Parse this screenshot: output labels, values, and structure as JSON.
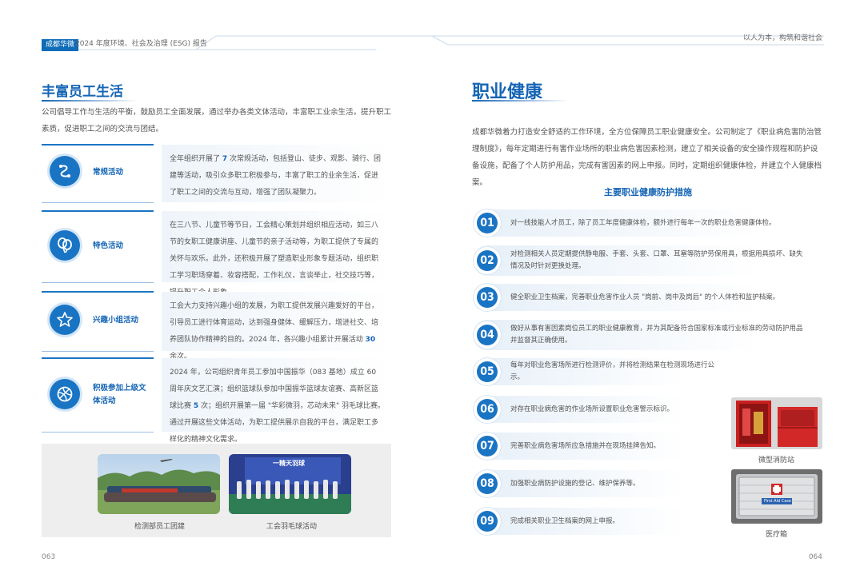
{
  "header": {
    "badge": "成都华微",
    "title": "2024 年度环境、社会及治理 (ESG) 报告",
    "right": "以人为本，构筑和谐社会"
  },
  "left": {
    "title": "丰富员工生活",
    "intro": "公司倡导工作与生活的平衡，鼓励员工全面发展，通过举办各类文体活动，丰富职工业余生活，提升职工素质，促进职工之间的交流与团结。",
    "activities": [
      {
        "icon": "activity-icon",
        "label": "常规活动",
        "pre": "全年组织开展了 ",
        "num": "7",
        "post": " 次常规活动，包括登山、徒步、观影、骑行、团建等活动，吸引众多职工积极参与，丰富了职工的业余生活，促进了职工之间的交流与互动，增强了团队凝聚力。"
      },
      {
        "icon": "balloon-icon",
        "label": "特色活动",
        "pre": "在三八节、儿童节等节日，工会精心策划并组织相应活动，如三八节的女职工健康讲座、儿童节的亲子活动等，为职工提供了专属的关怀与欢乐。此外，还积极开展了塑造职业形象专题活动，组织职工学习职场穿着、妆容搭配，工作礼仪，言谈举止，社交技巧等，提升职工个人形象。",
        "num": "",
        "post": ""
      },
      {
        "icon": "star-icon",
        "label": "兴趣小组活动",
        "pre": "工会大力支持兴趣小组的发展，为职工提供发展兴趣爱好的平台，引导员工进行体育运动，达到强身健体、缓解压力，增进社交、培养团队协作精神的目的。2024 年，各兴趣小组累计开展活动 ",
        "num": "30",
        "post": " 余次。"
      },
      {
        "icon": "ball-icon",
        "label": "积极参加上级文体活动",
        "pre": "2024 年，公司组织青年员工参加中国振华（083 基地）成立 60 周年庆文艺汇演；组织篮球队参加中国振华篮球友谊赛、高新区篮球比赛 ",
        "num": "5",
        "post": " 次；组织开展第一届 \"华彩微羽，芯动未来\" 羽毛球比赛。通过开展这些文体活动，为职工提供展示自我的平台，满足职工多样化的精神文化需求。"
      }
    ],
    "photos": [
      {
        "caption": "检测部员工团建"
      },
      {
        "caption": "工会羽毛球活动",
        "banner": "一精天羽球"
      }
    ],
    "page": "063"
  },
  "right": {
    "title": "职业健康",
    "intro": "成都华微着力打造安全舒适的工作环境，全方位保障员工职业健康安全。公司制定了《职业病危害防治管理制度》，每年定期进行有害作业场所的职业病危害因素检测，建立了相关设备的安全操作规程和防护设备设施，配备了个人防护用品，完成有害因素的网上申报。同时，定期组织健康体检，并建立个人健康档案。",
    "subtitle": "主要职业健康防护措施",
    "measures": [
      {
        "num": "01",
        "text": "对一线技能人才员工，除了员工年度健康体检，额外进行每年一次的职业危害健康体检。"
      },
      {
        "num": "02",
        "text": "对检测相关人员定期提供静电服、手套、头套、口罩、耳塞等防护劳保用具，根据用具损坏、缺失情况及时针对更换处理。"
      },
      {
        "num": "03",
        "text": "健全职业卫生档案，完善职业危害作业人员 \"岗前、岗中及岗后\" 的个人体检和监护档案。"
      },
      {
        "num": "04",
        "text": "做好从事有害因素岗位员工的职业健康教育，并为其配备符合国家标准或行业标准的劳动防护用品并监督其正确使用。"
      },
      {
        "num": "05",
        "text": "每年对职业危害场所进行检测评价，并将检测结果在检测现场进行公示。"
      },
      {
        "num": "06",
        "text": "对存在职业病危害的作业场所设置职业危害警示标识。"
      },
      {
        "num": "07",
        "text": "完善职业病危害场所应急措施并在现场挂牌告知。"
      },
      {
        "num": "08",
        "text": "加强职业病防护设施的登记、维护保养等。"
      },
      {
        "num": "09",
        "text": "完成相关职业卫生档案的网上申报。"
      }
    ],
    "photos": [
      {
        "caption": "微型消防站"
      },
      {
        "caption": "医疗箱",
        "label": "First Aid Case"
      }
    ],
    "page": "064"
  }
}
